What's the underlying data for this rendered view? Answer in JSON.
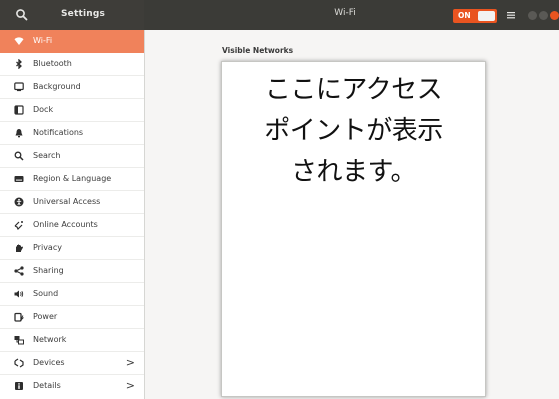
{
  "header": {
    "app_title": "Settings",
    "panel_title": "Wi-Fi",
    "wifi_switch_label": "ON",
    "accent": "#e95420"
  },
  "sidebar": {
    "active_color": "#f0825b",
    "items": [
      {
        "label": "Wi-Fi",
        "icon": "wifi-icon"
      },
      {
        "label": "Bluetooth",
        "icon": "bluetooth-icon"
      },
      {
        "label": "Background",
        "icon": "background-icon"
      },
      {
        "label": "Dock",
        "icon": "dock-icon"
      },
      {
        "label": "Notifications",
        "icon": "bell-icon"
      },
      {
        "label": "Search",
        "icon": "search-icon"
      },
      {
        "label": "Region & Language",
        "icon": "keyboard-icon"
      },
      {
        "label": "Universal Access",
        "icon": "accessibility-icon"
      },
      {
        "label": "Online Accounts",
        "icon": "online-accounts-icon"
      },
      {
        "label": "Privacy",
        "icon": "privacy-hand-icon"
      },
      {
        "label": "Sharing",
        "icon": "share-icon"
      },
      {
        "label": "Sound",
        "icon": "speaker-icon"
      },
      {
        "label": "Power",
        "icon": "battery-icon"
      },
      {
        "label": "Network",
        "icon": "network-icon"
      },
      {
        "label": "Devices",
        "icon": "devices-icon"
      },
      {
        "label": "Details",
        "icon": "details-icon"
      }
    ]
  },
  "main": {
    "visible_networks_label": "Visible Networks",
    "placeholder_note": "ここにアクセス\nポイントが表示\nされます。"
  }
}
